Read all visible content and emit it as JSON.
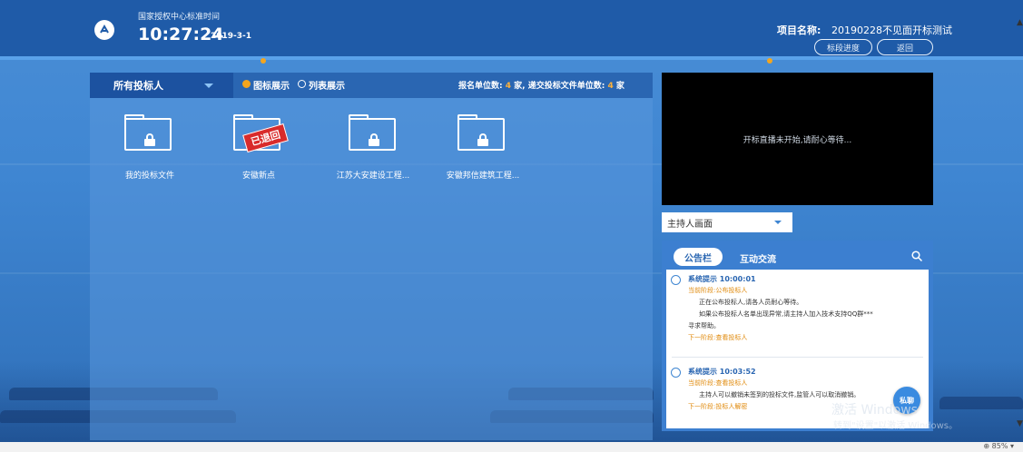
{
  "header": {
    "time_caption": "国家授权中心标准时间",
    "time": "10:27:24",
    "date": "2019-3-1",
    "project_label": "项目名称:",
    "project_name": "20190228不见面开标测试",
    "progress_button": "标段进度",
    "back_button": "返回",
    "logo_icon": "logo-icon"
  },
  "bidders_panel": {
    "filter_value": "所有投标人",
    "view_icon_label": "图标展示",
    "view_list_label": "列表展示",
    "selected_view": "图标展示",
    "stats_signup_label": "报名单位数:",
    "stats_signup_count": "4",
    "stats_unit1": "家,",
    "stats_submitted_label": "递交投标文件单位数:",
    "stats_submitted_count": "4",
    "stats_unit2": "家",
    "folders": [
      {
        "name": "我的投标文件",
        "icon": "locked-folder-icon"
      },
      {
        "name": "安徽新点",
        "icon": "locked-folder-icon",
        "stamp": "已退回"
      },
      {
        "name": "江苏大安建设工程...",
        "icon": "locked-folder-icon"
      },
      {
        "name": "安徽邦信建筑工程...",
        "icon": "locked-folder-icon"
      }
    ]
  },
  "video": {
    "message": "开标直播未开始,请耐心等待..."
  },
  "host_view": {
    "selected": "主持人画面"
  },
  "chat": {
    "tab_notice": "公告栏",
    "tab_interact": "互动交流",
    "active_tab": "公告栏",
    "messages": [
      {
        "title": "系统提示 10:00:01",
        "stage": "当前阶段:公布投标人",
        "line1": "正在公布投标人,请各人员耐心等待。",
        "line2": "如果公布投标人名单出现异常,请主持人加入技术支持QQ群***",
        "line3": "寻求帮助。",
        "next": "下一阶段:查看投标人"
      },
      {
        "title": "系统提示 10:03:52",
        "stage": "当前阶段:查看投标人",
        "line1": "主持人可以撤销未签到的投标文件,监管人可以取消撤销。",
        "next": "下一阶段:投标人解密"
      }
    ],
    "private_button": "私聊"
  },
  "watermark": {
    "line1": "激活 Windows",
    "line2": "转到\"设置\"以激活 Windows。"
  },
  "status": {
    "zoom": "85%"
  }
}
